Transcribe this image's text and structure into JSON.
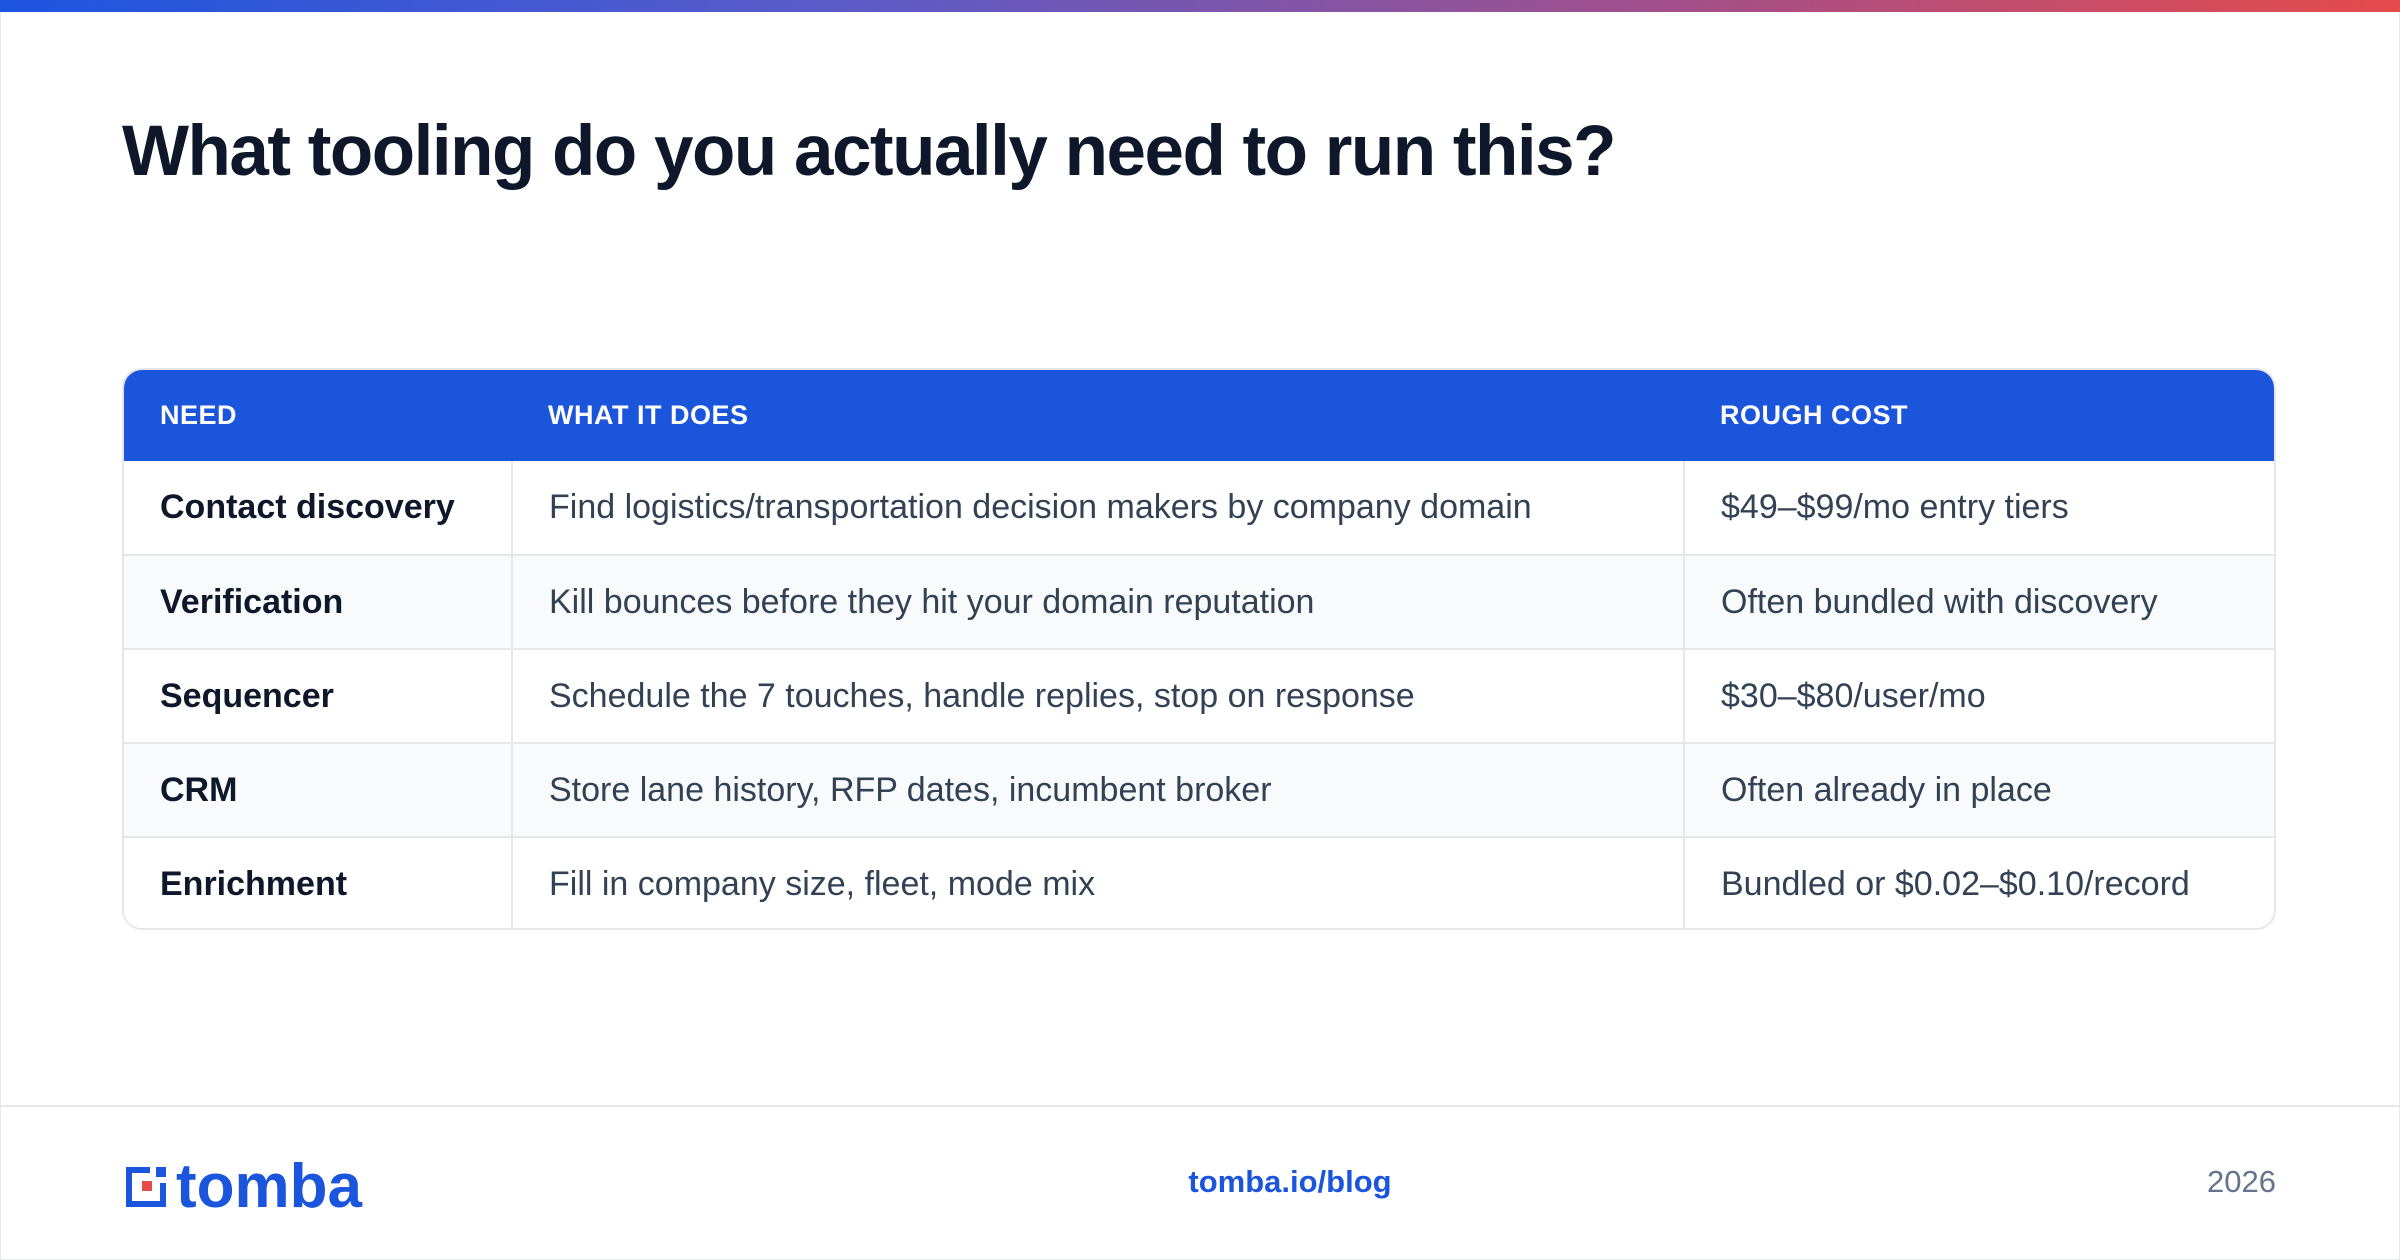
{
  "title": "What tooling do you actually need to run this?",
  "table": {
    "headers": [
      "NEED",
      "WHAT IT DOES",
      "ROUGH COST"
    ],
    "rows": [
      [
        "Contact discovery",
        "Find logistics/transportation decision makers by company domain",
        "$49–$99/mo entry tiers"
      ],
      [
        "Verification",
        "Kill bounces before they hit your domain reputation",
        "Often bundled with discovery"
      ],
      [
        "Sequencer",
        "Schedule the 7 touches, handle replies, stop on response",
        "$30–$80/user/mo"
      ],
      [
        "CRM",
        "Store lane history, RFP dates, incumbent broker",
        "Often already in place"
      ],
      [
        "Enrichment",
        "Fill in company size, fleet, mode mix",
        "Bundled or $0.02–$0.10/record"
      ]
    ]
  },
  "footer": {
    "logo_text": "tomba",
    "link": "tomba.io/blog",
    "year": "2026"
  },
  "colors": {
    "brand_blue": "#1b55dc",
    "accent_red": "#e64b4b",
    "title_dark": "#0f172a"
  }
}
